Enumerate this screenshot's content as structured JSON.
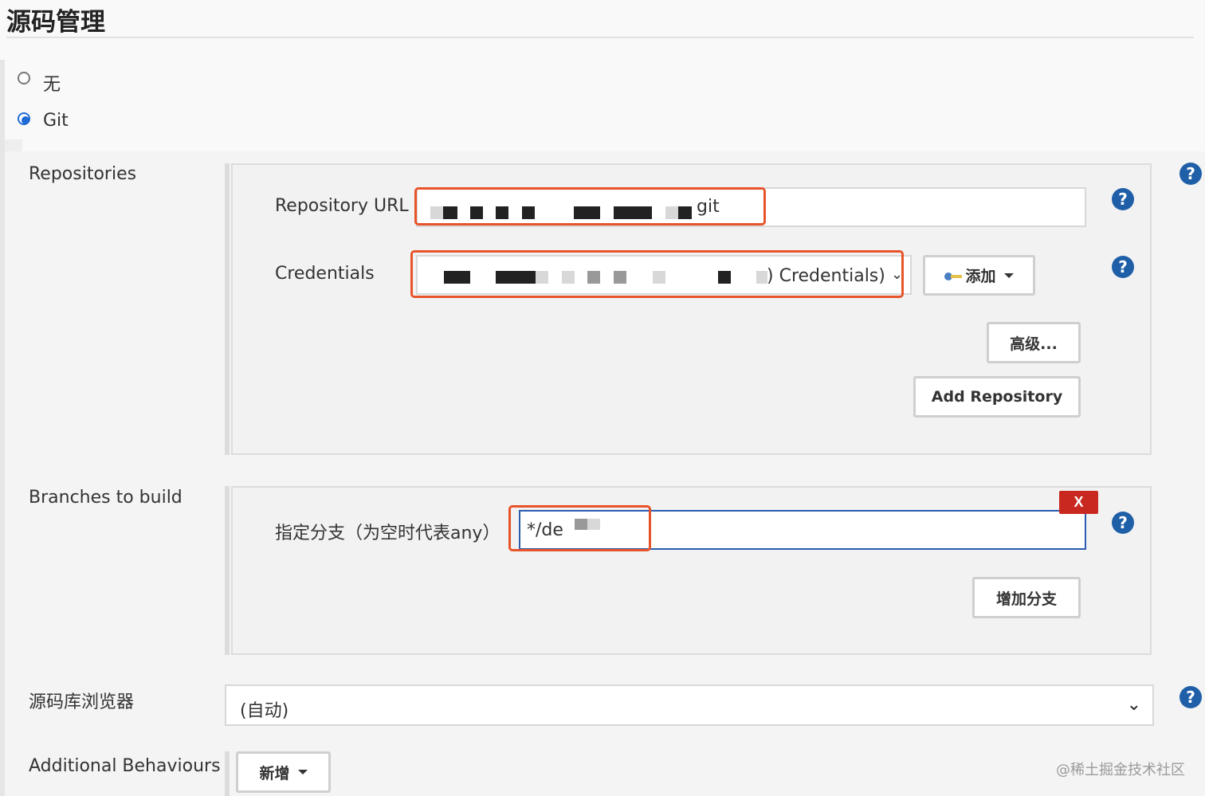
{
  "section_title": "源码管理",
  "scm_options": [
    {
      "label": "无",
      "selected": false
    },
    {
      "label": "Git",
      "selected": true
    }
  ],
  "repositories": {
    "label": "Repositories",
    "repo_url_label": "Repository URL",
    "repo_url_value_suffix": "git",
    "credentials_label": "Credentials",
    "credentials_value_suffix": ") Credentials)",
    "add_button": "添加",
    "advanced_button": "高级...",
    "add_repository_button": "Add Repository"
  },
  "branches": {
    "label": "Branches to build",
    "branch_label": "指定分支（为空时代表any）",
    "branch_value": "*/de",
    "delete_button": "X",
    "add_branch_button": "增加分支"
  },
  "browser": {
    "label": "源码库浏览器",
    "selected": "(自动)"
  },
  "behaviours": {
    "label": "Additional Behaviours",
    "add_button": "新增"
  },
  "help_symbol": "?",
  "watermark": "@稀土掘金技术社区",
  "colors": {
    "highlight": "#e8542a",
    "help": "#1f5fa8",
    "radio": "#1e6bd6",
    "delete": "#c8281f",
    "focus_border": "#2a5db0"
  }
}
